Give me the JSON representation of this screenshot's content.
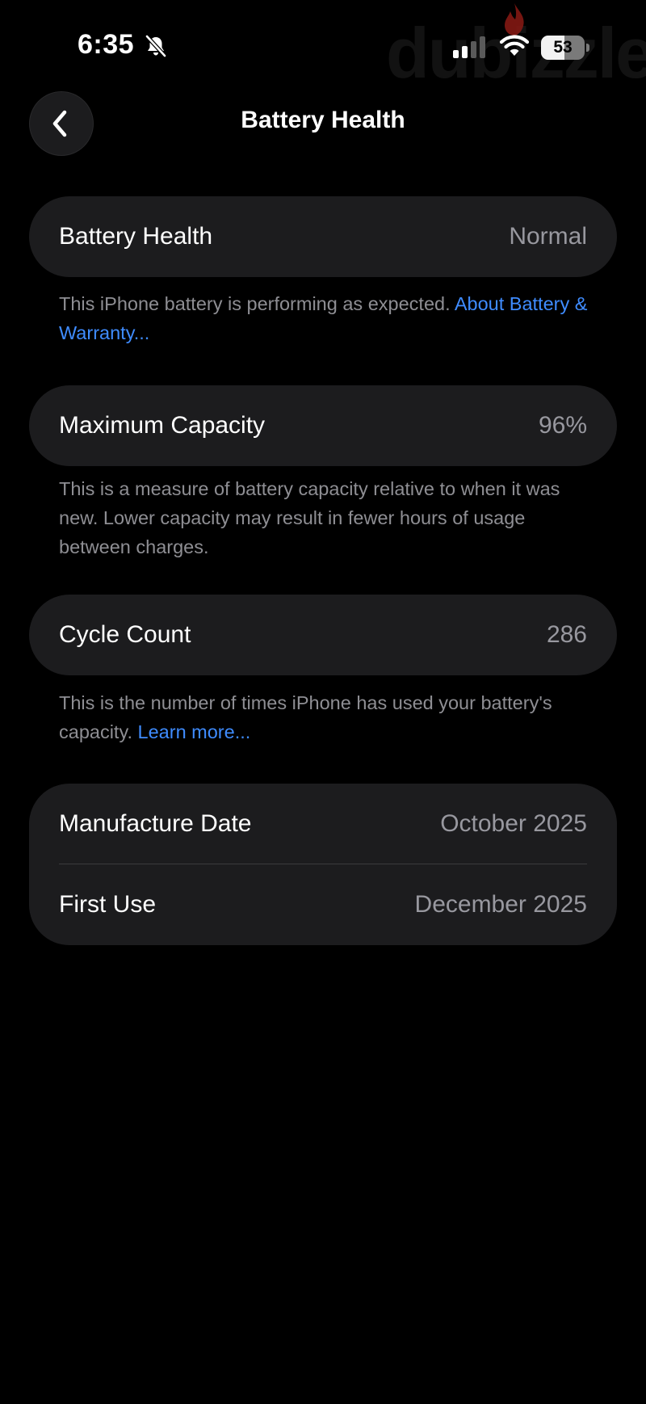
{
  "status_bar": {
    "time": "6:35",
    "battery_level": "53",
    "battery_fraction": 0.53,
    "signal_bars_active": 2,
    "signal_bars_total": 4
  },
  "watermark": {
    "text": "dubizzle"
  },
  "nav": {
    "title": "Battery Health"
  },
  "sections": {
    "health": {
      "label": "Battery Health",
      "value": "Normal",
      "footnote_text": "This iPhone battery is performing as expected. ",
      "footnote_link": "About Battery & Warranty..."
    },
    "capacity": {
      "label": "Maximum Capacity",
      "value": "96%",
      "footnote_text": "This is a measure of battery capacity relative to when it was new. Lower capacity may result in fewer hours of usage between charges."
    },
    "cycles": {
      "label": "Cycle Count",
      "value": "286",
      "footnote_text": "This is the number of times iPhone has used your battery's capacity. ",
      "footnote_link": "Learn more..."
    },
    "dates": {
      "manufacture_label": "Manufacture Date",
      "manufacture_value": "October 2025",
      "first_use_label": "First Use",
      "first_use_value": "December 2025"
    }
  },
  "colors": {
    "background": "#000000",
    "card": "#1c1c1e",
    "secondary_text": "#98989f",
    "link": "#3f8cff"
  }
}
